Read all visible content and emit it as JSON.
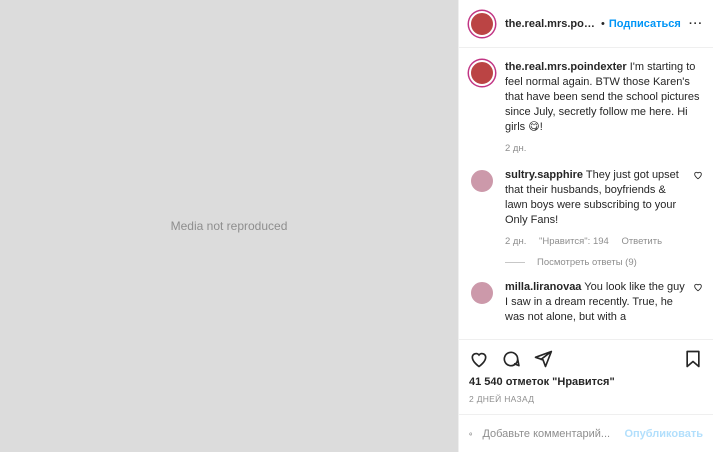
{
  "media": {
    "placeholder": "Media not reproduced"
  },
  "header": {
    "username": "the.real.mrs.poindexter",
    "separator": "•",
    "follow_label": "Подписаться",
    "more_label": "···"
  },
  "caption": {
    "username": "the.real.mrs.poindexter",
    "text": "I'm starting to feel normal again. BTW those Karen's that have been send the school pictures since July, secretly follow me here. Hi girls 😋!",
    "time": "2 дн."
  },
  "comments": [
    {
      "username": "sultry.sapphire",
      "text": "They just got upset that their husbands, boyfriends & lawn boys were subscribing to your Only Fans!",
      "time": "2 дн.",
      "likes": "\"Нравится\": 194",
      "reply_label": "Ответить",
      "view_replies": "Посмотреть ответы (9)"
    },
    {
      "username": "milla.liranovaa",
      "text": "You look like the guy I saw in a dream recently. True, he was not alone, but with a"
    }
  ],
  "actions": {
    "likes": "41 540 отметок \"Нравится\"",
    "date": "2 дней назад"
  },
  "compose": {
    "placeholder": "Добавьте комментарий...",
    "post_label": "Опубликовать"
  }
}
